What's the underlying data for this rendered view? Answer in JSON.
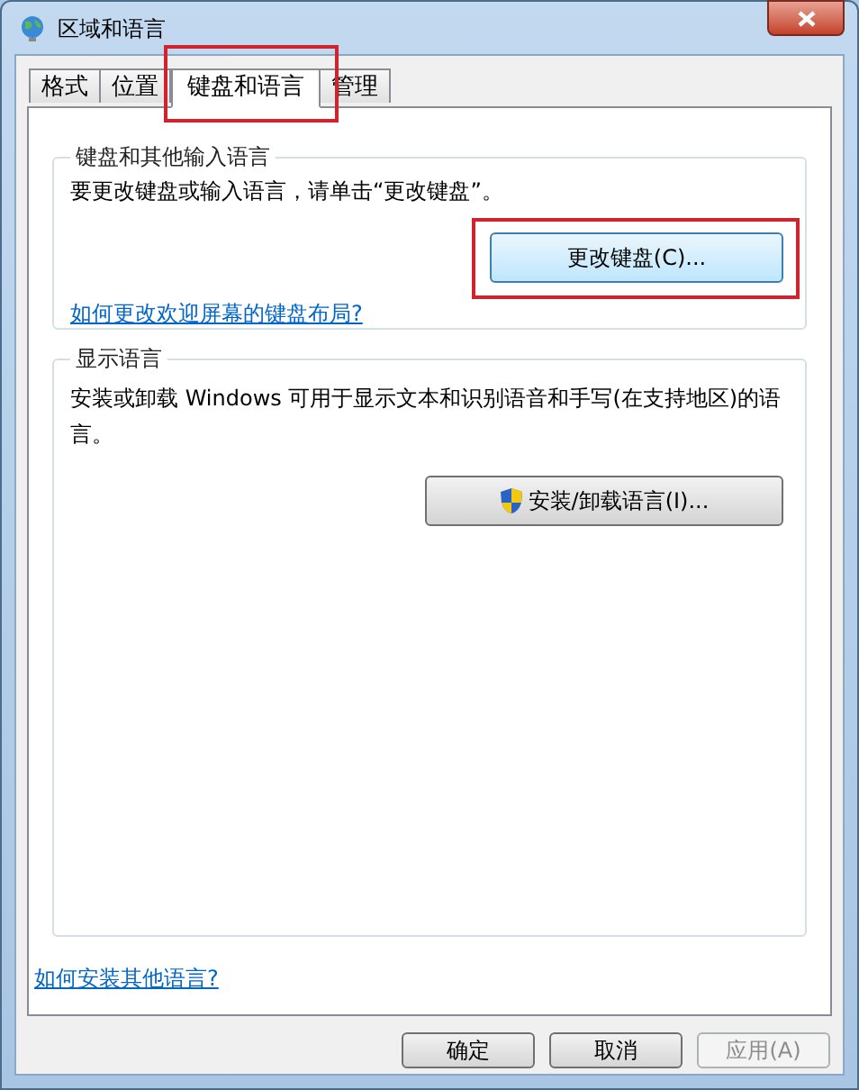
{
  "window": {
    "title": "区域和语言"
  },
  "tabs": [
    {
      "label": "格式",
      "selected": false,
      "highlighted": false
    },
    {
      "label": "位置",
      "selected": false,
      "highlighted": false
    },
    {
      "label": "键盘和语言",
      "selected": true,
      "highlighted": true
    },
    {
      "label": "管理",
      "selected": false,
      "highlighted": false
    }
  ],
  "keyboard_group": {
    "title": "键盘和其他输入语言",
    "description": "要更改键盘或输入语言，请单击“更改键盘”。",
    "button": {
      "label": "更改键盘(C)...",
      "highlighted": true
    },
    "link": "如何更改欢迎屏幕的键盘布局?"
  },
  "display_group": {
    "title": "显示语言",
    "description": "安装或卸载 Windows 可用于显示文本和识别语音和手写(在支持地区)的语言。",
    "button": {
      "label": "安装/卸载语言(I)...",
      "shield": true
    }
  },
  "link": "如何安装其他语言?",
  "buttons": [
    {
      "label": "确定",
      "disabled": false
    },
    {
      "label": "取消",
      "disabled": false
    },
    {
      "label": "应用(A)",
      "disabled": true
    }
  ]
}
